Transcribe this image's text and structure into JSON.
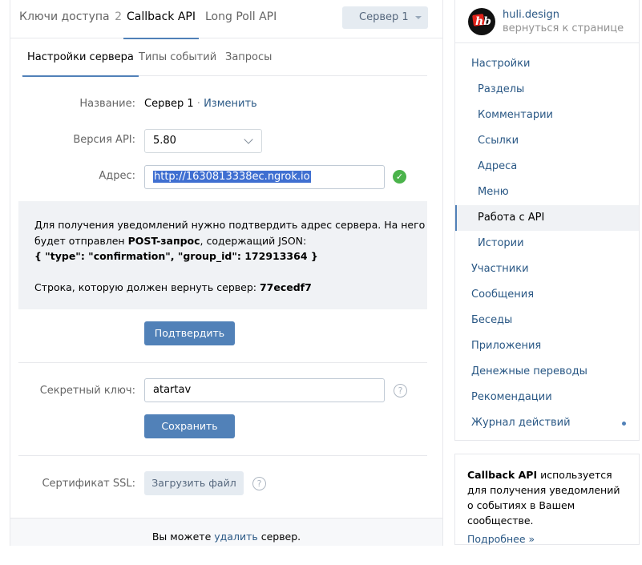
{
  "top_tabs": [
    {
      "label": "Ключи доступа",
      "count": "2"
    },
    {
      "label": "Callback API"
    },
    {
      "label": "Long Poll API"
    }
  ],
  "server_select": "Сервер 1",
  "sub_tabs": [
    "Настройки сервера",
    "Типы событий",
    "Запросы"
  ],
  "form": {
    "name_label": "Название:",
    "name_value": "Сервер 1",
    "name_sep": " · ",
    "name_change": "Изменить",
    "api_label": "Версия API:",
    "api_value": "5.80",
    "address_label": "Адрес:",
    "address_value": "http://1630813338ec.ngrok.io"
  },
  "confirm_info": {
    "line1": "Для получения уведомлений нужно подтвердить адрес сервера. На него",
    "line2_pre": "будет отправлен ",
    "line2_bold": "POST-запрос",
    "line2_post": ", содержащий JSON:",
    "json": "{ \"type\": \"confirmation\", \"group_id\": 172913364 }",
    "return_pre": "Строка, которую должен вернуть сервер: ",
    "return_code": "77ecedf7"
  },
  "confirm_button": "Подтвердить",
  "secret": {
    "label": "Секретный ключ:",
    "value": "atartav",
    "save_button": "Сохранить"
  },
  "ssl": {
    "label": "Сертификат SSL:",
    "upload_button": "Загрузить файл"
  },
  "help_glyph": "?",
  "footer": {
    "pre": "Вы можете ",
    "link": "удалить",
    "post": " сервер."
  },
  "group": {
    "name": "huli.design",
    "back": "вернуться к странице"
  },
  "menu": [
    {
      "label": "Настройки"
    },
    {
      "label": "Разделы"
    },
    {
      "label": "Комментарии"
    },
    {
      "label": "Ссылки"
    },
    {
      "label": "Адреса"
    },
    {
      "label": "Меню"
    },
    {
      "label": "Работа с API"
    },
    {
      "label": "Истории"
    },
    {
      "label": "Участники"
    },
    {
      "label": "Сообщения"
    },
    {
      "label": "Беседы"
    },
    {
      "label": "Приложения"
    },
    {
      "label": "Денежные переводы"
    },
    {
      "label": "Рекомендации"
    },
    {
      "label": "Журнал действий"
    }
  ],
  "right_info": {
    "bold": "Callback API",
    "text": " используется для получения уведомлений о событиях в Вашем сообществе.",
    "more": "Подробнее »"
  },
  "colors": {
    "accent": "#5181b8",
    "link": "#2a5885",
    "success": "#4bb34b"
  }
}
